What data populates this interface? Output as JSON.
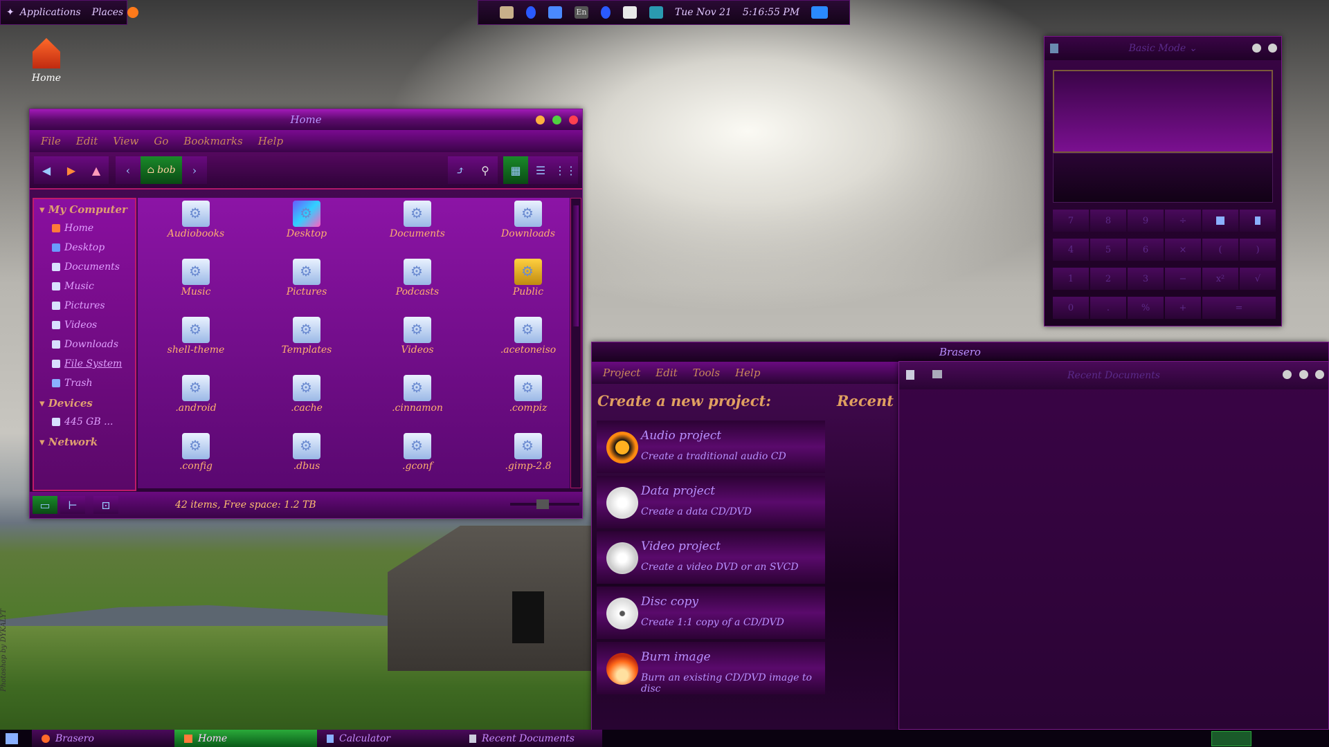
{
  "top_panel": {
    "menu_applications": "Applications",
    "menu_places": "Places",
    "date": "Tue Nov 21",
    "time": "5:16:55 PM",
    "keyboard": "En"
  },
  "desktop": {
    "home_label": "Home",
    "watermark": "Photoshop by DYKALYT"
  },
  "file_manager": {
    "title": "Home",
    "menu": [
      "File",
      "Edit",
      "View",
      "Go",
      "Bookmarks",
      "Help"
    ],
    "path_button": "bob",
    "sidebar": {
      "sections": [
        {
          "heading": "My Computer",
          "items": [
            "Home",
            "Desktop",
            "Documents",
            "Music",
            "Pictures",
            "Videos",
            "Downloads",
            "File System",
            "Trash"
          ]
        },
        {
          "heading": "Devices",
          "items": [
            "445 GB ..."
          ]
        },
        {
          "heading": "Network",
          "items": []
        }
      ]
    },
    "files": [
      "Audiobooks",
      "Desktop",
      "Documents",
      "Downloads",
      "Music",
      "Pictures",
      "Podcasts",
      "Public",
      "shell-theme",
      "Templates",
      "Videos",
      ".acetoneiso",
      ".android",
      ".cache",
      ".cinnamon",
      ".compiz",
      ".config",
      ".dbus",
      ".gconf",
      ".gimp-2.8"
    ],
    "status": "42 items, Free space: 1.2 TB"
  },
  "calculator": {
    "mode": "Basic Mode ⌄",
    "keys": [
      [
        "7",
        "8",
        "9",
        "÷",
        "",
        ""
      ],
      [
        "4",
        "5",
        "6",
        "×",
        "(",
        ")"
      ],
      [
        "1",
        "2",
        "3",
        "−",
        "x²",
        "√"
      ],
      [
        "0",
        ".",
        "%",
        "+",
        "="
      ]
    ]
  },
  "brasero": {
    "title": "Brasero",
    "menu": [
      "Project",
      "Edit",
      "Tools",
      "Help"
    ],
    "create_heading": "Create a new project:",
    "recent_heading": "Recent pr",
    "projects": [
      {
        "title": "Audio project",
        "subtitle": "Create a traditional audio CD"
      },
      {
        "title": "Data project",
        "subtitle": "Create a data CD/DVD"
      },
      {
        "title": "Video project",
        "subtitle": "Create a video DVD or an SVCD"
      },
      {
        "title": "Disc copy",
        "subtitle": "Create 1:1 copy of a CD/DVD"
      },
      {
        "title": "Burn image",
        "subtitle": "Burn an existing CD/DVD image to disc"
      }
    ]
  },
  "recent_documents": {
    "title": "Recent Documents"
  },
  "taskbar": {
    "items": [
      "Brasero",
      "Home",
      "Calculator",
      "Recent Documents"
    ]
  },
  "colors": {
    "accent": "#8c14a6",
    "file_label": "#ffb070",
    "active_task": "#1a7a2a"
  }
}
